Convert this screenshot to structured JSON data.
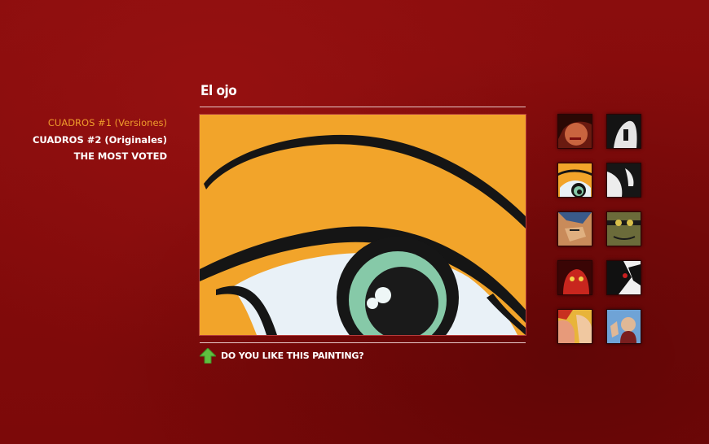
{
  "nav": {
    "items": [
      {
        "label": "CUADROS #1 (Versiones)",
        "active": true
      },
      {
        "label": "CUADROS #2 (Originales)",
        "active": false
      },
      {
        "label": "THE MOST VOTED",
        "active": false
      }
    ]
  },
  "painting": {
    "title": "El ojo",
    "vote_label": "DO YOU LIKE THIS PAINTING?"
  },
  "colors": {
    "background": "#820b0b",
    "accent": "#ef9c2c",
    "painting_orange": "#f2a42a",
    "vote_arrow": "#5fbf3f"
  },
  "thumbnails": [
    {
      "icon": "woman-face-thumbnail"
    },
    {
      "icon": "bw-figure-thumbnail"
    },
    {
      "icon": "eye-thumbnail"
    },
    {
      "icon": "bw-face-thumbnail"
    },
    {
      "icon": "comic-face-thumbnail"
    },
    {
      "icon": "green-villain-thumbnail"
    },
    {
      "icon": "red-devil-thumbnail"
    },
    {
      "icon": "bw-hero-thumbnail"
    },
    {
      "icon": "comic-couple-thumbnail"
    },
    {
      "icon": "blue-comic-thumbnail"
    }
  ]
}
